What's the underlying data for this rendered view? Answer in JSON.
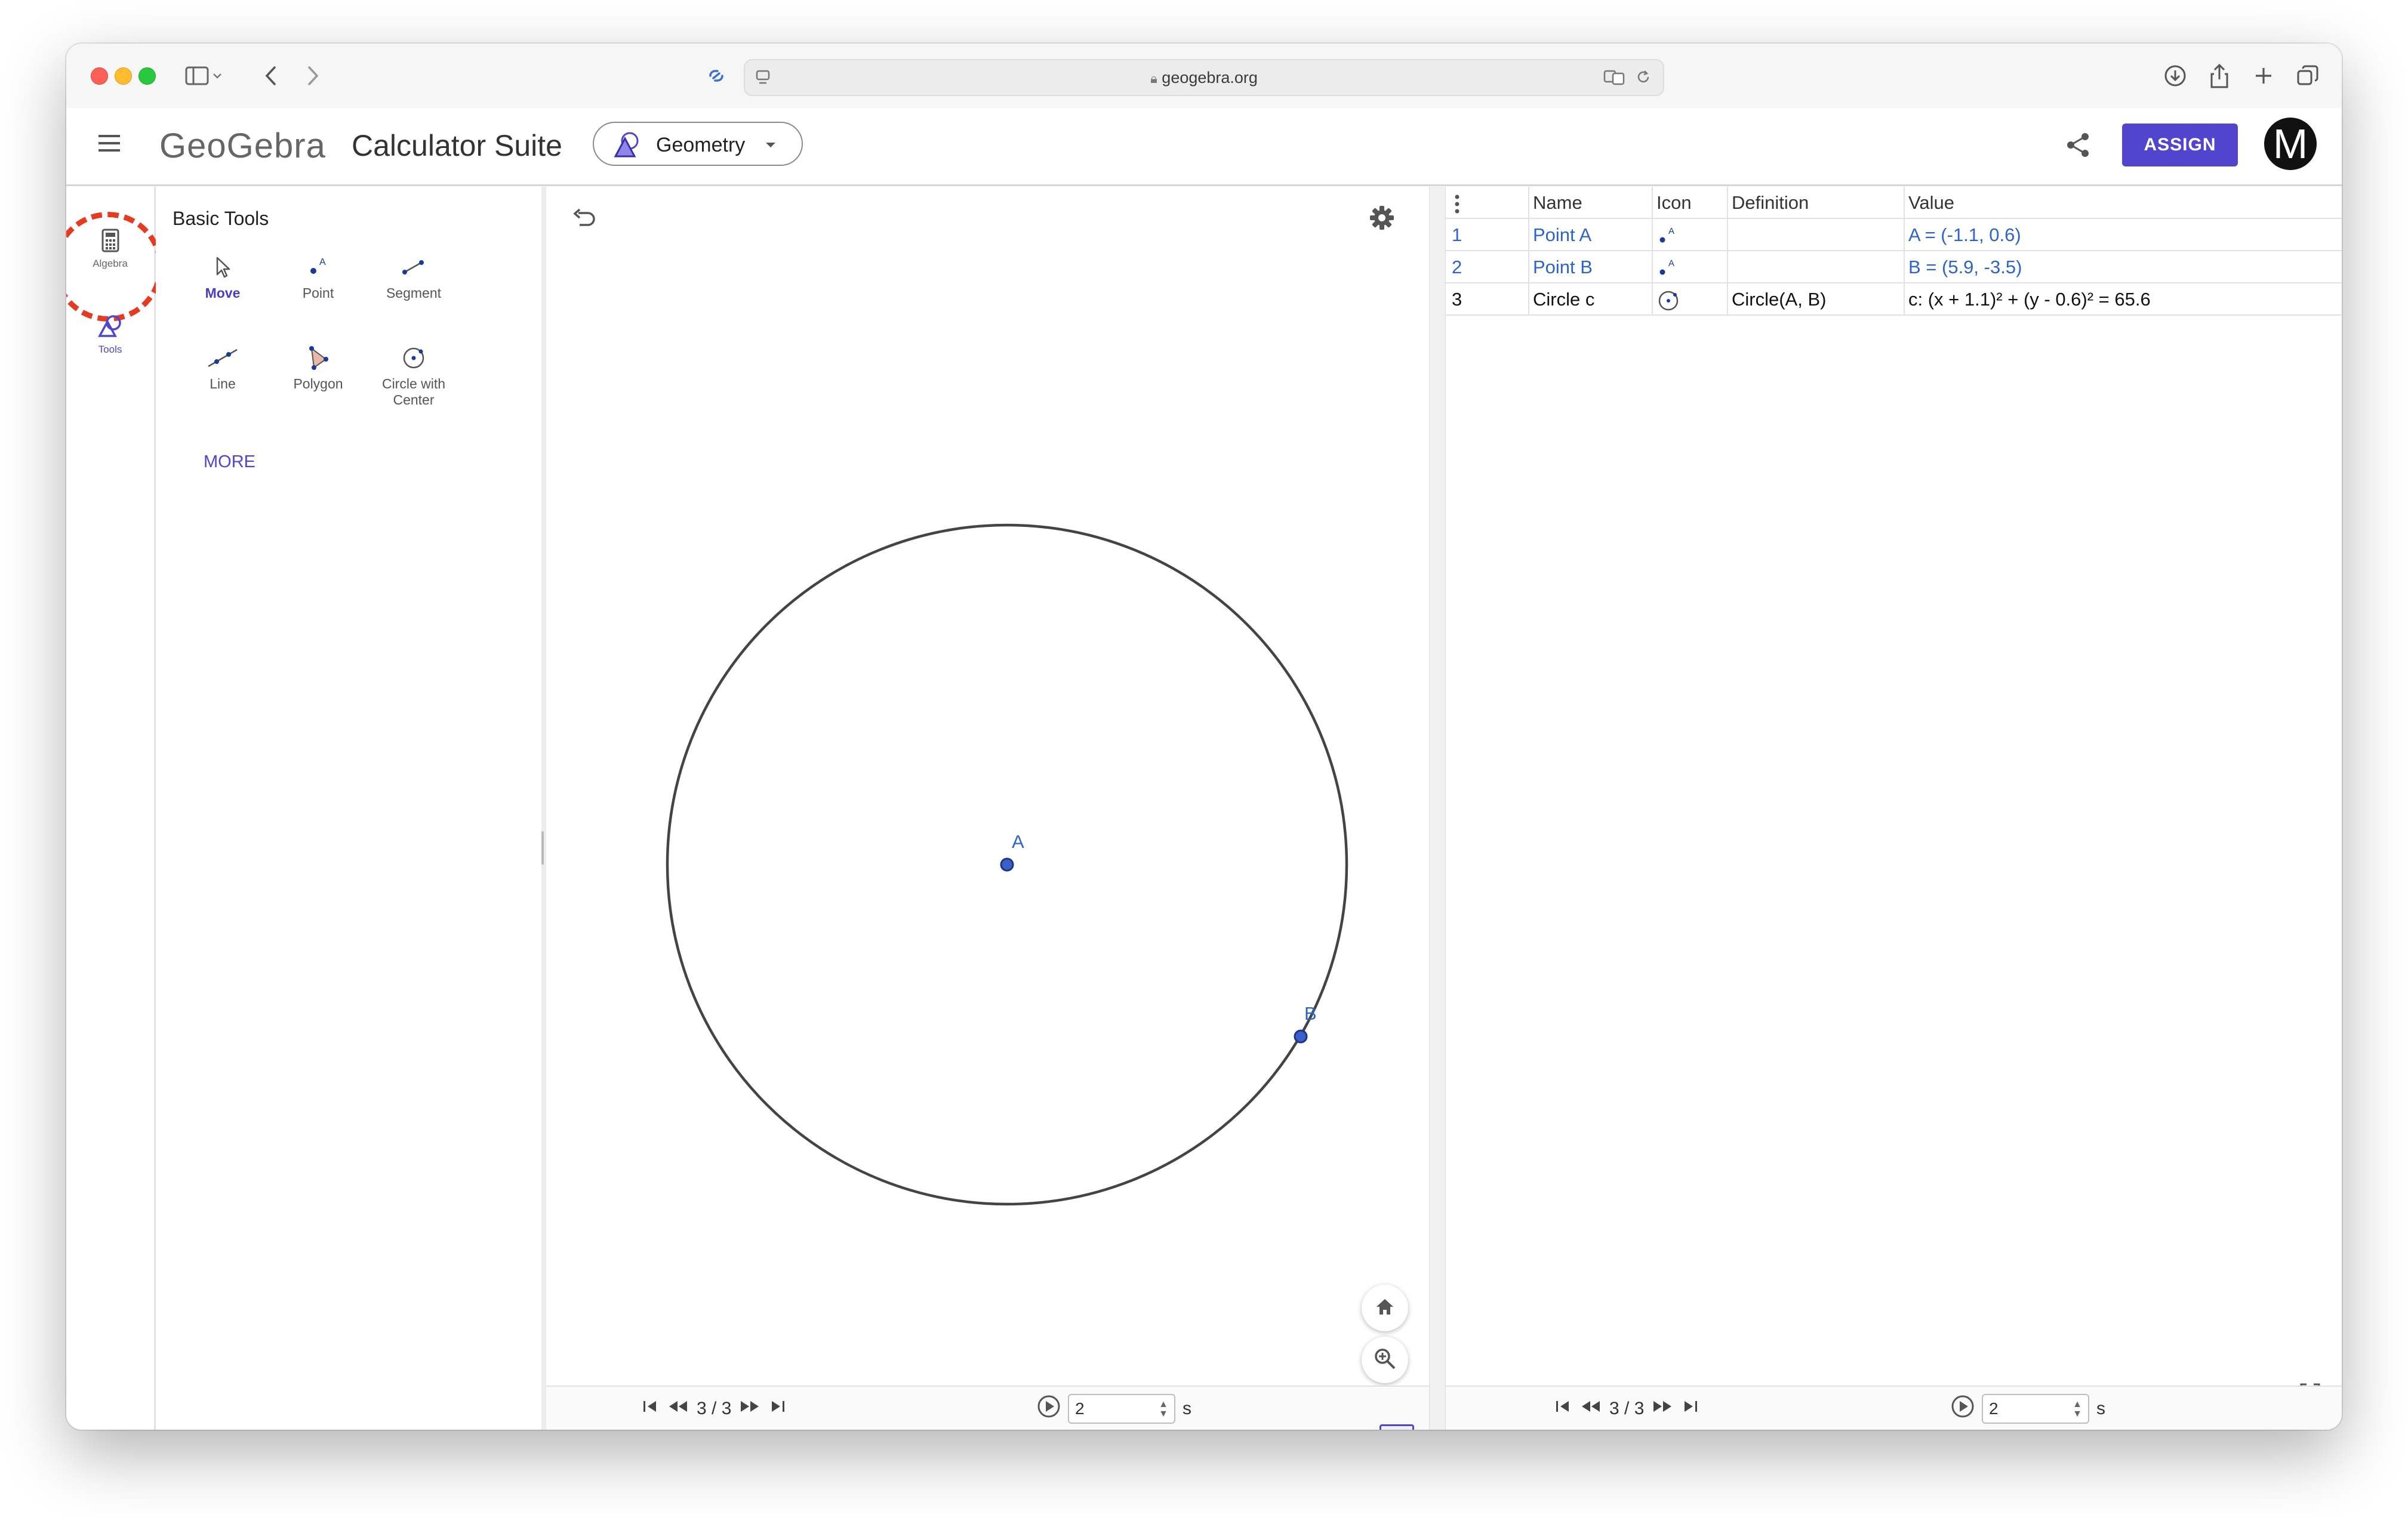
{
  "browser": {
    "url": "geogebra.org"
  },
  "app": {
    "logo": "GeoGebra",
    "suite_title": "Calculator Suite",
    "app_selector": "Geometry",
    "assign_label": "ASSIGN",
    "avatar_letter": "M",
    "accent_color": "#5145cd"
  },
  "rail": {
    "items": [
      {
        "label": "Algebra",
        "icon": "calculator-icon",
        "highlighted": true
      },
      {
        "label": "Tools",
        "icon": "tools-shapes-icon",
        "active": true
      }
    ]
  },
  "tools_panel": {
    "title": "Basic Tools",
    "tools": [
      {
        "label": "Move",
        "icon": "cursor-arrow-icon",
        "active": true
      },
      {
        "label": "Point",
        "icon": "point-icon"
      },
      {
        "label": "Segment",
        "icon": "segment-icon"
      },
      {
        "label": "Line",
        "icon": "line-icon"
      },
      {
        "label": "Polygon",
        "icon": "polygon-icon"
      },
      {
        "label": "Circle with",
        "label2": "Center",
        "icon": "circle-center-icon"
      }
    ],
    "more_label": "MORE"
  },
  "graphics": {
    "point_a_label": "A",
    "point_b_label": "B",
    "nav": {
      "step": "3 / 3",
      "speed": "2",
      "unit": "s"
    }
  },
  "protocol": {
    "columns": [
      "Name",
      "Icon",
      "Definition",
      "Value"
    ],
    "rows": [
      {
        "num": "1",
        "name": "Point A",
        "definition": "",
        "value": "A = (-1.1, 0.6)"
      },
      {
        "num": "2",
        "name": "Point B",
        "definition": "",
        "value": "B = (5.9, -3.5)"
      },
      {
        "num": "3",
        "name": "Circle c",
        "definition": "Circle(A, B)",
        "value": "c: (x + 1.1)² + (y - 0.6)² = 65.6"
      }
    ],
    "nav": {
      "step": "3 / 3",
      "speed": "2",
      "unit": "s"
    }
  }
}
